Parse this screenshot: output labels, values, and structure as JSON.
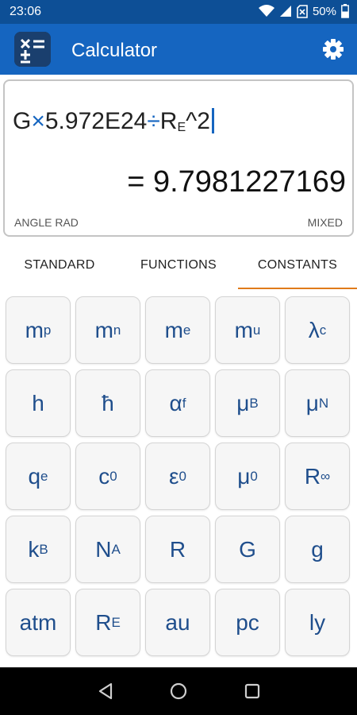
{
  "status_bar": {
    "time": "23:06",
    "battery_percent": "50%",
    "icons": [
      "wifi-icon",
      "signal-icon",
      "no-sim-icon",
      "battery-icon"
    ]
  },
  "app_bar": {
    "title": "Calculator",
    "logo_icon": "calculator-logo-icon",
    "settings_icon": "gear-icon"
  },
  "display": {
    "expression": [
      {
        "t": "G",
        "op": false
      },
      {
        "t": "×",
        "op": true
      },
      {
        "t": "5.972E24",
        "op": false
      },
      {
        "t": "÷",
        "op": true
      },
      {
        "t": "R",
        "sub": "E",
        "op": false
      },
      {
        "t": "^2",
        "op": false
      }
    ],
    "result": "= 9.7981227169",
    "angle_mode": "ANGLE RAD",
    "format_mode": "MIXED"
  },
  "tabs": [
    {
      "label": "STANDARD",
      "active": false
    },
    {
      "label": "FUNCTIONS",
      "active": false
    },
    {
      "label": "CONSTANTS",
      "active": true
    }
  ],
  "keys": [
    [
      {
        "sym": "m",
        "sub": "p"
      },
      {
        "sym": "m",
        "sub": "n"
      },
      {
        "sym": "m",
        "sub": "e"
      },
      {
        "sym": "m",
        "sub": "u"
      },
      {
        "sym": "λ",
        "sub": "c"
      }
    ],
    [
      {
        "sym": "h",
        "sub": ""
      },
      {
        "sym": "ħ",
        "sub": ""
      },
      {
        "sym": "α",
        "sub": "f"
      },
      {
        "sym": "μ",
        "sub": "B"
      },
      {
        "sym": "μ",
        "sub": "N"
      }
    ],
    [
      {
        "sym": "q",
        "sub": "e"
      },
      {
        "sym": "c",
        "sub": "0"
      },
      {
        "sym": "ε",
        "sub": "0"
      },
      {
        "sym": "μ",
        "sub": "0"
      },
      {
        "sym": "R",
        "sub": "∞"
      }
    ],
    [
      {
        "sym": "k",
        "sub": "B"
      },
      {
        "sym": "N",
        "sub": "A"
      },
      {
        "sym": "R",
        "sub": ""
      },
      {
        "sym": "G",
        "sub": ""
      },
      {
        "sym": "g",
        "sub": ""
      }
    ],
    [
      {
        "sym": "atm",
        "sub": ""
      },
      {
        "sym": "R",
        "sub": "E"
      },
      {
        "sym": "au",
        "sub": ""
      },
      {
        "sym": "pc",
        "sub": ""
      },
      {
        "sym": "ly",
        "sub": ""
      }
    ]
  ],
  "nav_bar": {
    "buttons": [
      "back-icon",
      "home-icon",
      "recents-icon"
    ]
  },
  "colors": {
    "status_bar": "#0d4f96",
    "app_bar": "#1565c0",
    "key_text": "#1f4e8c",
    "tab_indicator": "#e07b1a",
    "operator": "#1565c0"
  }
}
